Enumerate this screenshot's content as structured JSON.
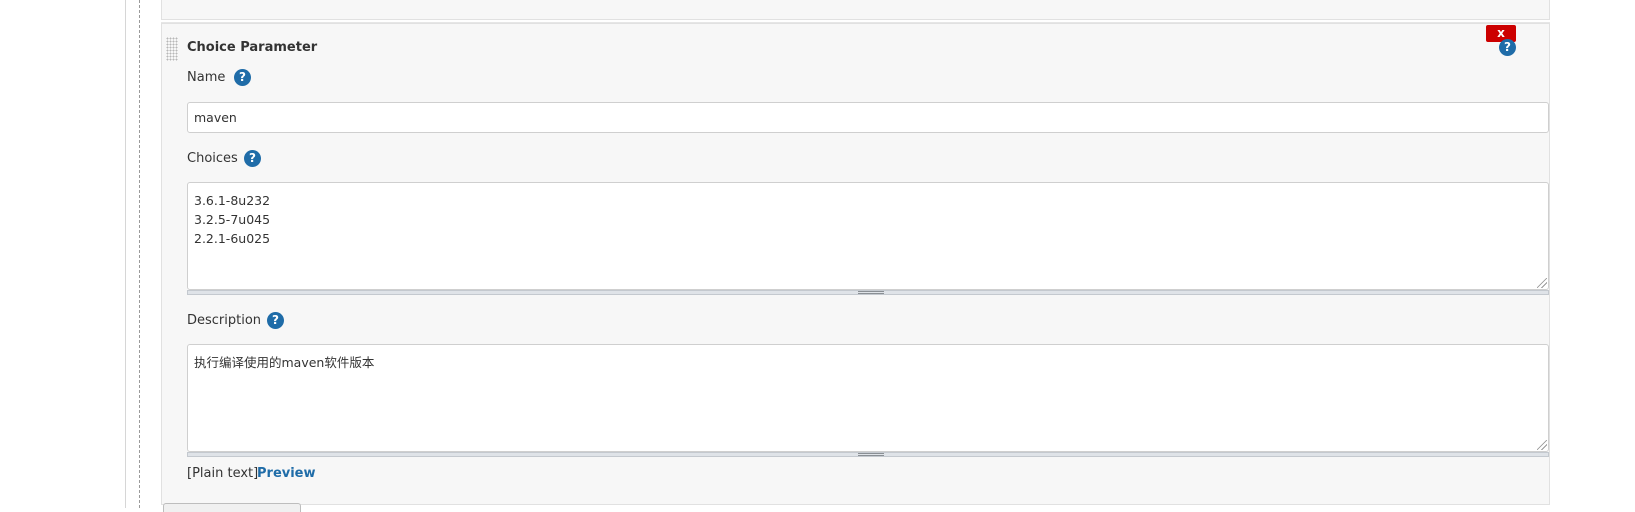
{
  "parameter": {
    "title": "Choice Parameter",
    "delete_label": "x",
    "help_icon": "question-mark-icon",
    "name": {
      "label": "Name",
      "value": "maven"
    },
    "choices": {
      "label": "Choices",
      "lines": [
        "3.6.1-8u232",
        "3.2.5-7u045",
        "2.2.1-6u025"
      ]
    },
    "description": {
      "label": "Description",
      "value": "执行编译使用的maven软件版本",
      "format_label": "[Plain text]",
      "preview_label": "Preview"
    }
  },
  "colors": {
    "delete_button": "#cc0000",
    "help_icon": "#1f6ca8",
    "link": "#1f6ca8",
    "block_background": "#f7f7f7"
  }
}
